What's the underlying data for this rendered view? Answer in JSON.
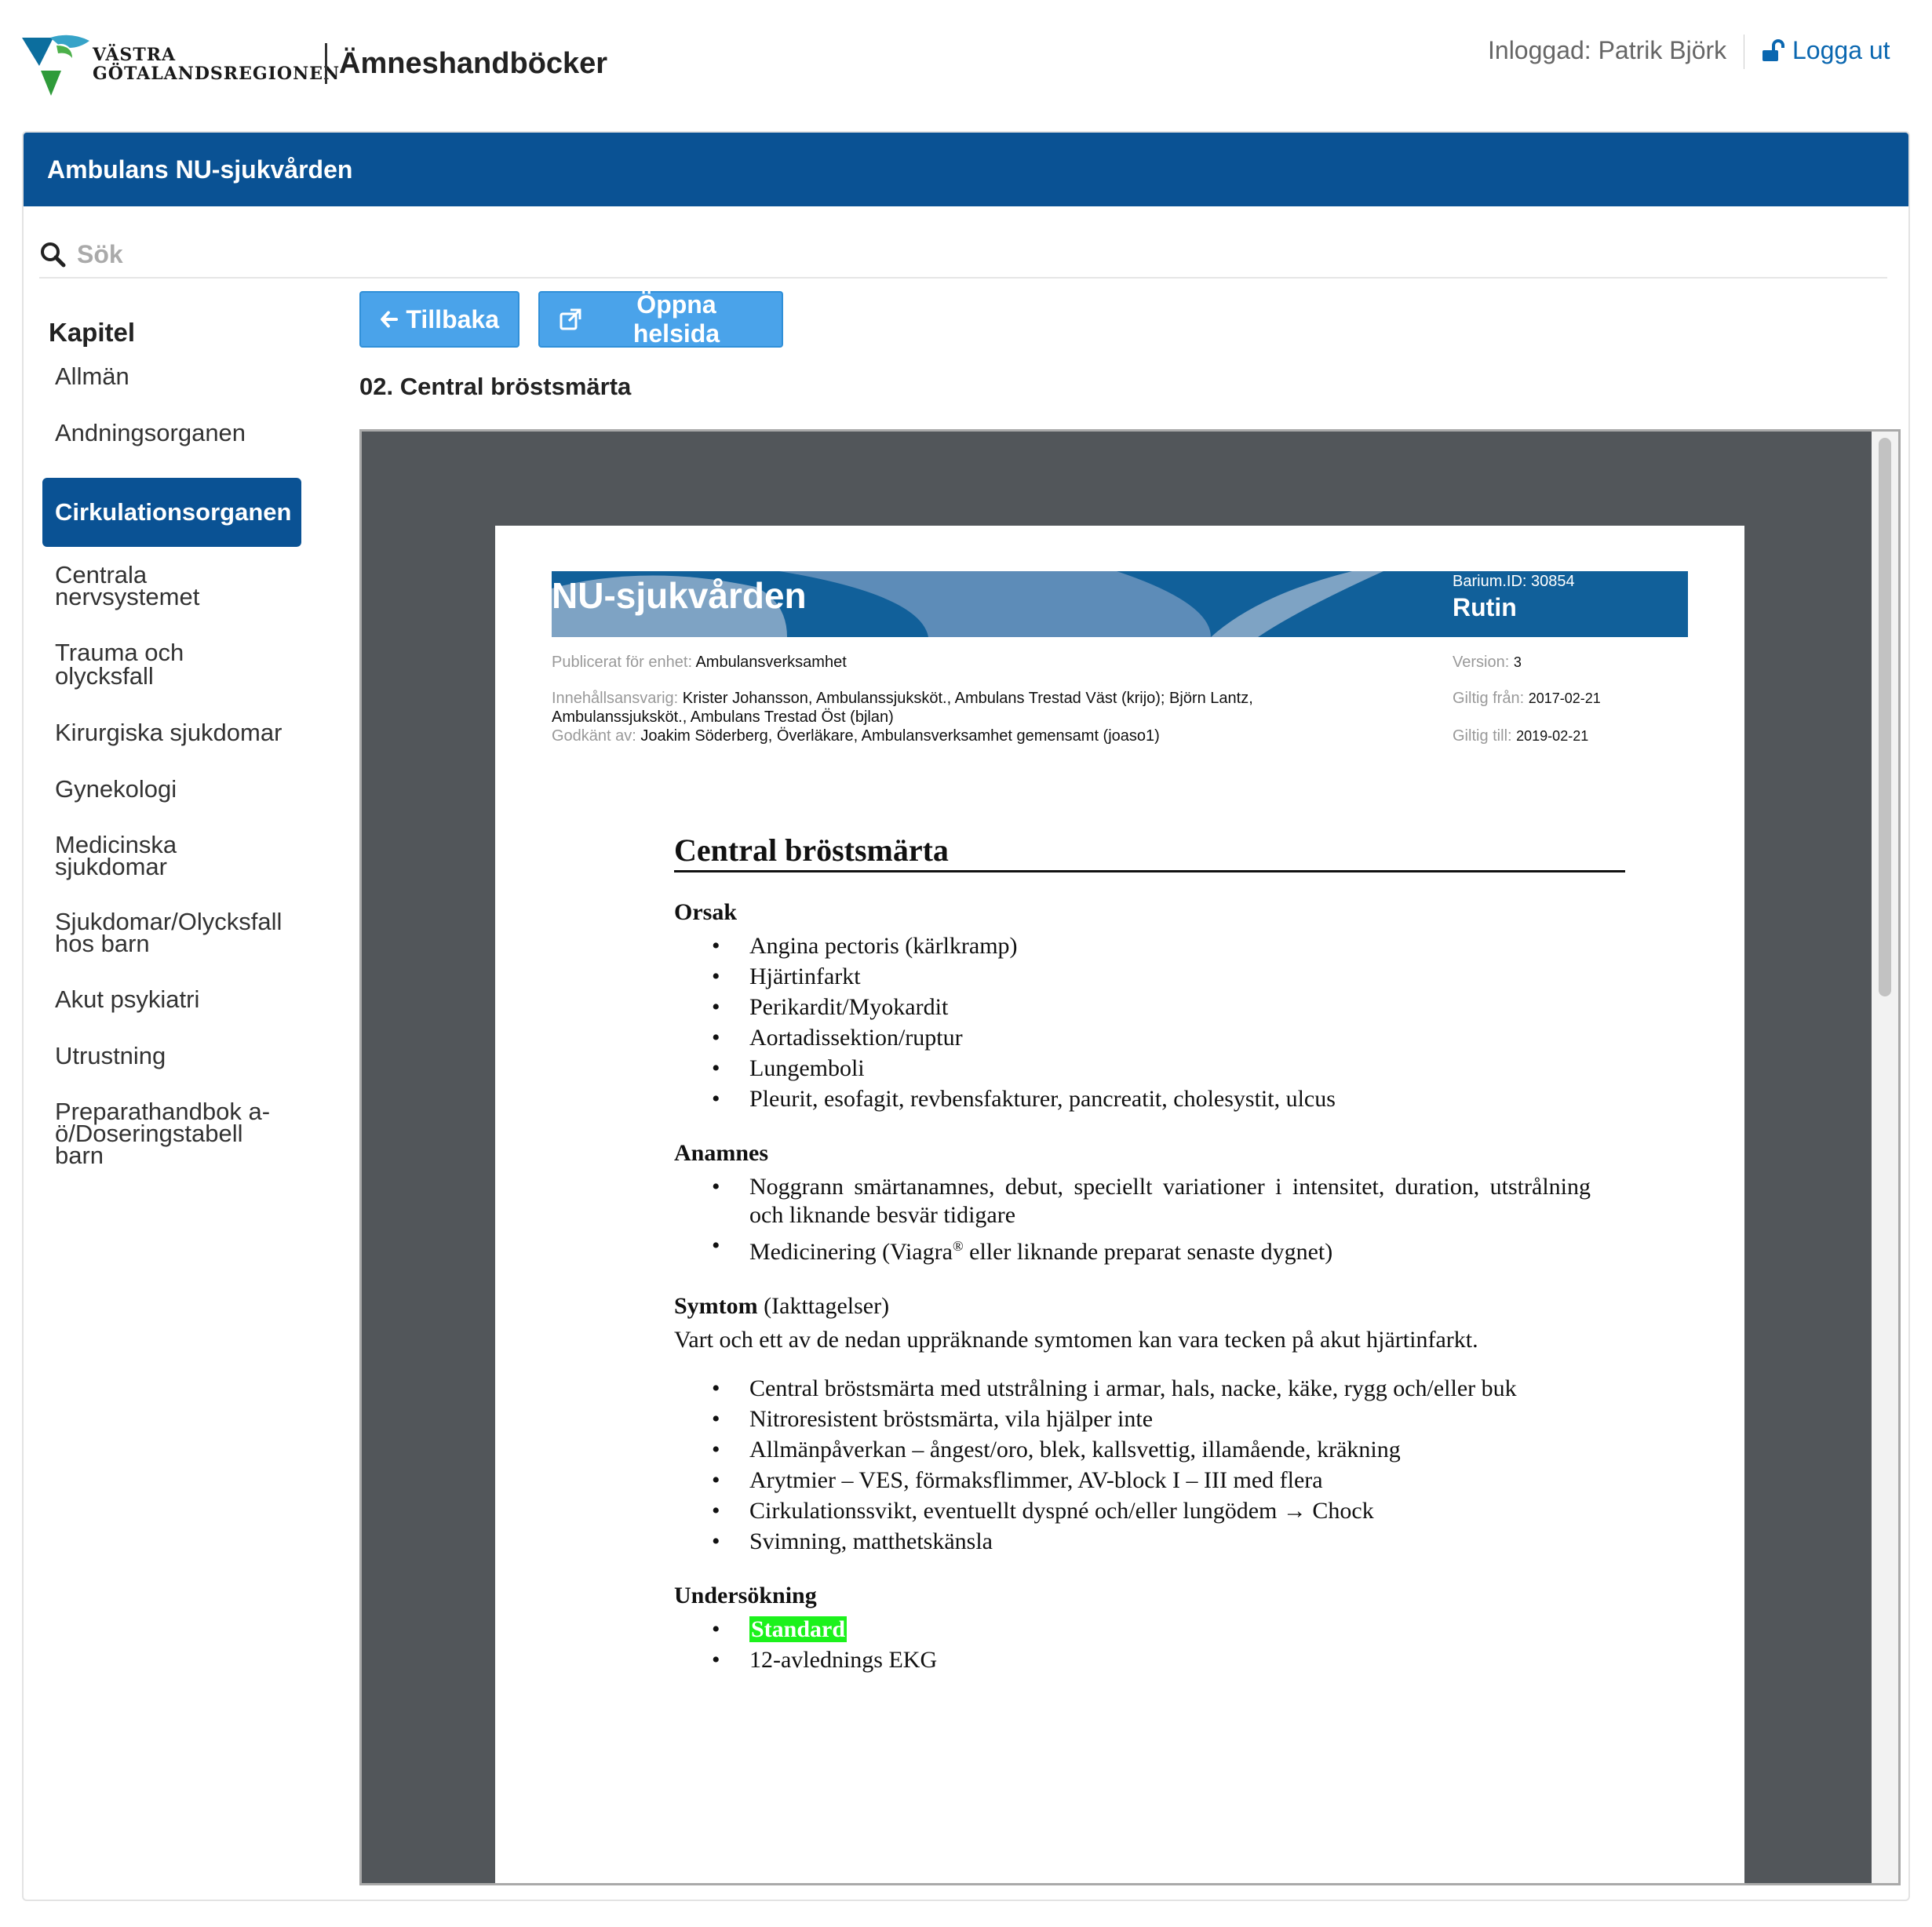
{
  "header": {
    "logo_line1": "VÄSTRA",
    "logo_line2": "GÖTALANDSREGIONEN",
    "app_title": "Ämneshandböcker",
    "logged_in": "Inloggad: Patrik Björk",
    "logout": "Logga ut"
  },
  "panel": {
    "title": "Ambulans NU-sjukvården",
    "search_placeholder": "Sök"
  },
  "sidebar": {
    "title": "Kapitel",
    "items": [
      {
        "label": "Allmän"
      },
      {
        "label": "Andningsorganen"
      },
      {
        "label": "Cirkulationsorganen",
        "active": true
      },
      {
        "label": "Centrala nervsystemet"
      },
      {
        "label": "Trauma och olycksfall"
      },
      {
        "label": "Kirurgiska sjukdomar"
      },
      {
        "label": "Gynekologi"
      },
      {
        "label": "Medicinska sjukdomar"
      },
      {
        "label": "Sjukdomar/Olycksfall hos barn"
      },
      {
        "label": "Akut psykiatri"
      },
      {
        "label": "Utrustning"
      },
      {
        "label": "Preparathandbok a-ö/Doseringstabell barn"
      }
    ]
  },
  "content": {
    "back_button": "Tillbaka",
    "open_full_button": "Öppna helsida",
    "title": "02. Central bröstsmärta"
  },
  "document": {
    "org": "NU-sjukvården",
    "barium_id": "Barium.ID: 30854",
    "doc_type": "Rutin",
    "published_label": "Publicerat för enhet:",
    "published_value": "Ambulansverksamhet",
    "responsible_label": "Innehållsansvarig:",
    "responsible_value": "Krister Johansson, Ambulanssjuksköt., Ambulans Trestad Väst (krijo); Björn Lantz, Ambulanssjuksköt., Ambulans Trestad Öst (bjlan)",
    "approved_label": "Godkänt av:",
    "approved_value": "Joakim Söderberg, Överläkare, Ambulansverksamhet gemensamt (joaso1)",
    "version_label": "Version:",
    "version_value": "3",
    "valid_from_label": "Giltig från:",
    "valid_from_value": "2017-02-21",
    "valid_to_label": "Giltig till:",
    "valid_to_value": "2019-02-21",
    "heading": "Central bröstsmärta",
    "orsak_title": "Orsak",
    "orsak_items": [
      "Angina pectoris (kärlkramp)",
      "Hjärtinfarkt",
      "Perikardit/Myokardit",
      "Aortadissektion/ruptur",
      "Lungemboli",
      "Pleurit, esofagit, revbensfakturer, pancreatit, cholesystit, ulcus"
    ],
    "anamnes_title": "Anamnes",
    "anamnes_item1": "Noggrann smärtanamnes, debut, speciellt variationer i intensitet, duration, utstrålning och liknande besvär tidigare",
    "anamnes_item2_a": "Medicinering (Viagra",
    "anamnes_item2_sup": "®",
    "anamnes_item2_b": " eller liknande preparat senaste dygnet)",
    "symtom_title": "Symtom",
    "symtom_sub": "(Iakttagelser)",
    "symtom_intro": "Vart och ett av de nedan uppräknande symtomen kan vara tecken på akut hjärtinfarkt.",
    "symtom_items": [
      "Central bröstsmärta med utstrålning i armar, hals, nacke, käke, rygg och/eller buk",
      "Nitroresistent bröstsmärta, vila hjälper inte",
      "Allmänpåverkan – ångest/oro, blek, kallsvettig, illamående, kräkning",
      "Arytmier – VES, förmaksflimmer, AV-block I – III med flera",
      "Cirkulationssvikt, eventuellt dyspné och/eller lungödem → Chock",
      "Svimning, matthetskänsla"
    ],
    "undersokning_title": "Undersökning",
    "undersokning_highlight": "Standard",
    "undersokning_item2": "12-avlednings EKG"
  },
  "colors": {
    "brand_blue": "#0a5294",
    "button_blue": "#4aa3ea",
    "link_blue": "#0a67b0",
    "highlight_green": "#1cf21c",
    "viewer_bg": "#52565a"
  }
}
